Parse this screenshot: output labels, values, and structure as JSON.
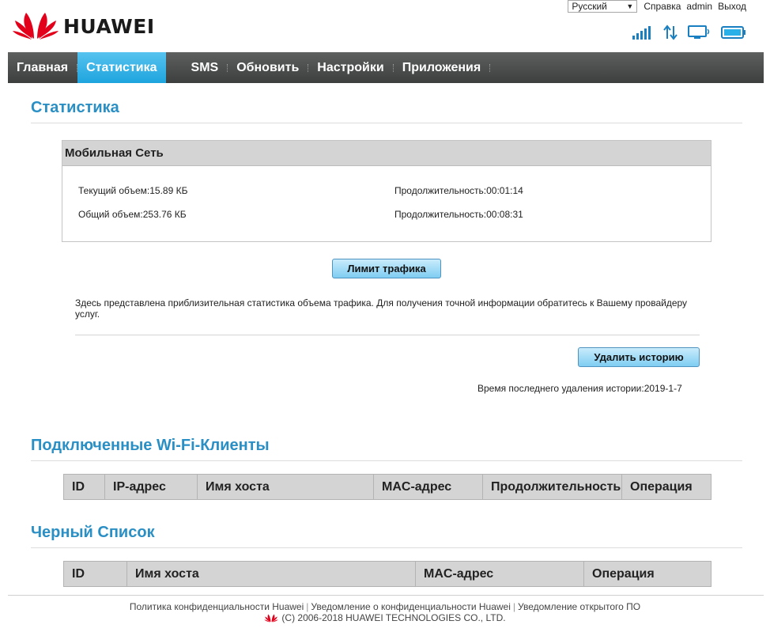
{
  "header": {
    "brand": "HUAWEI",
    "language": "Русский",
    "links": [
      "Справка",
      "admin",
      "Выход"
    ]
  },
  "nav": {
    "items": [
      "Главная",
      "Статистика",
      "SMS",
      "Обновить",
      "Настройки",
      "Приложения"
    ],
    "active": "Статистика"
  },
  "statistics": {
    "title": "Статистика",
    "panel_title": "Мобильная Сеть",
    "current_volume": "Текущий объем:15.89 КБ",
    "current_duration": "Продолжительность:00:01:14",
    "total_volume": "Общий объем:253.76 КБ",
    "total_duration": "Продолжительность:00:08:31",
    "limit_button": "Лимит трафика",
    "note": "Здесь представлена приблизительная статистика объема трафика. Для получения точной информации обратитесь к Вашему провайдеру услуг.",
    "delete_button": "Удалить историю",
    "last_deleted": "Время последнего удаления истории:2019-1-7"
  },
  "wifi_clients": {
    "title": "Подключенные Wi-Fi-Клиенты",
    "columns": [
      "ID",
      "IP-адрес",
      "Имя хоста",
      "MAC-адрес",
      "Продолжительность",
      "Операция"
    ]
  },
  "blacklist": {
    "title": "Черный Список",
    "columns": [
      "ID",
      "Имя хоста",
      "MAC-адрес",
      "Операция"
    ]
  },
  "footer": {
    "links": [
      "Политика конфиденциальности Huawei",
      "Уведомление о конфиденциальности Huawei",
      "Уведомление открытого ПО"
    ],
    "copyright": "(C) 2006-2018 HUAWEI TECHNOLOGIES CO., LTD."
  },
  "colors": {
    "accent": "#2a8fc4",
    "nav_active": "#1ea4de",
    "brand_red": "#e3001b",
    "icon_blue": "#1a7fc1"
  },
  "icons": [
    "huawei-logo-icon",
    "signal-strength-icon",
    "data-transfer-icon",
    "wifi-monitor-icon",
    "battery-icon"
  ]
}
